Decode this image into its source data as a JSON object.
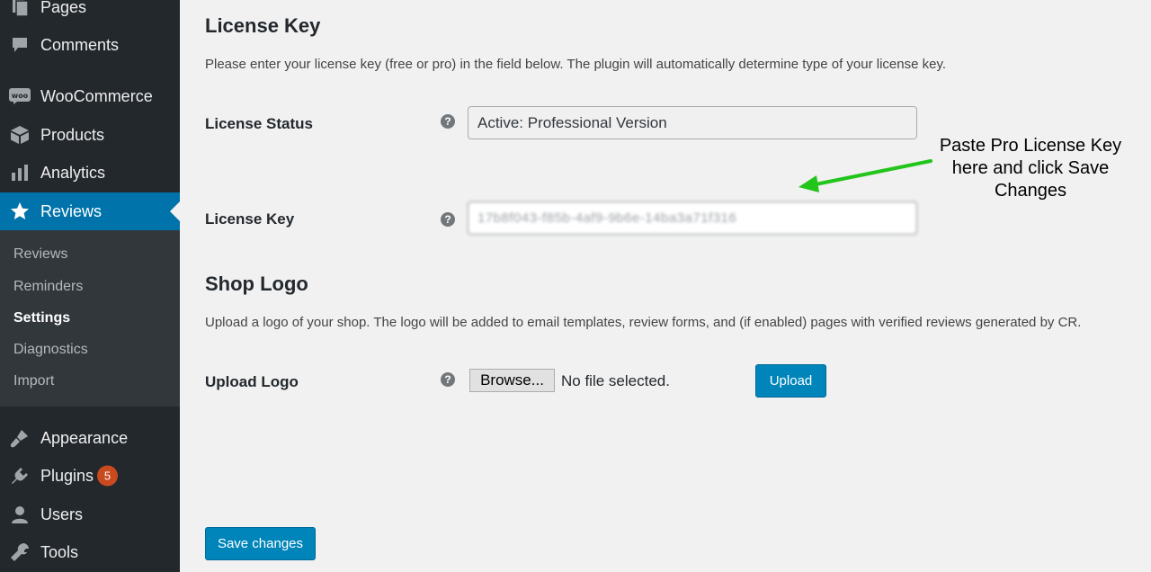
{
  "sidebar": {
    "menu": [
      {
        "label": "Pages",
        "icon": "pages-icon"
      },
      {
        "label": "Comments",
        "icon": "comments-icon"
      },
      {
        "label": "WooCommerce",
        "icon": "woocommerce-icon"
      },
      {
        "label": "Products",
        "icon": "products-icon"
      },
      {
        "label": "Analytics",
        "icon": "analytics-icon"
      },
      {
        "label": "Reviews",
        "icon": "star-icon"
      },
      {
        "label": "Appearance",
        "icon": "appearance-icon"
      },
      {
        "label": "Plugins",
        "icon": "plugins-icon",
        "badge": "5"
      },
      {
        "label": "Users",
        "icon": "users-icon"
      },
      {
        "label": "Tools",
        "icon": "tools-icon"
      }
    ],
    "submenu": [
      "Reviews",
      "Reminders",
      "Settings",
      "Diagnostics",
      "Import"
    ]
  },
  "license": {
    "title": "License Key",
    "description": "Please enter your license key (free or pro) in the field below. The plugin will automatically determine type of your license key.",
    "status_label": "License Status",
    "status_value": "Active: Professional Version",
    "key_label": "License Key",
    "key_value": "17b8f043-f85b-4af9-9b6e-14ba3a71f316"
  },
  "logo": {
    "title": "Shop Logo",
    "description": "Upload a logo of your shop. The logo will be added to email templates, review forms, and (if enabled) pages with verified reviews generated by CR.",
    "upload_label": "Upload Logo",
    "browse_label": "Browse...",
    "no_file_text": "No file selected.",
    "upload_button": "Upload"
  },
  "help_glyph": "?",
  "save_button": "Save changes",
  "annotation": {
    "text": "Paste Pro License Key here and click Save Changes"
  },
  "colors": {
    "sidebar_bg": "#23282d",
    "submenu_bg": "#32373c",
    "active_blue": "#0073aa",
    "button_blue": "#0085ba",
    "badge_orange": "#ca4a1f",
    "arrow_green": "#22c51a"
  }
}
